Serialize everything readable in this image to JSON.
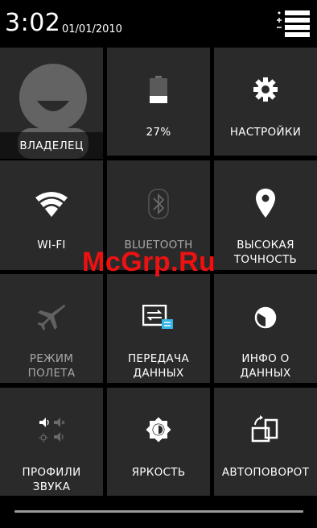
{
  "status_bar": {
    "time": "3:02",
    "date": "01/01/2010",
    "settings_icon": "settings-list-icon"
  },
  "tiles": [
    {
      "label": "ВЛАДЕЛЕЦ",
      "icon": "user-avatar-icon",
      "enabled": true
    },
    {
      "label": "27%",
      "icon": "battery-icon",
      "battery_level": 27,
      "enabled": true
    },
    {
      "label": "НАСТРОЙКИ",
      "icon": "gear-icon",
      "enabled": true
    },
    {
      "label": "WI-FI",
      "icon": "wifi-icon",
      "enabled": true
    },
    {
      "label": "BLUETOOTH",
      "icon": "bluetooth-icon",
      "enabled": false
    },
    {
      "label_line1": "ВЫСОКАЯ",
      "label_line2": "ТОЧНОСТЬ",
      "icon": "location-icon",
      "enabled": true
    },
    {
      "label_line1": "РЕЖИМ",
      "label_line2": "ПОЛЕТА",
      "icon": "airplane-icon",
      "enabled": false
    },
    {
      "label_line1": "ПЕРЕДАЧА",
      "label_line2": "ДАННЫХ",
      "icon": "data-transfer-icon",
      "enabled": true
    },
    {
      "label_line1": "ИНФО О",
      "label_line2": "ДАННЫХ",
      "icon": "data-usage-icon",
      "enabled": true
    },
    {
      "label_line1": "ПРОФИЛИ",
      "label_line2": "ЗВУКА",
      "icon": "sound-profiles-icon",
      "enabled": true
    },
    {
      "label": "ЯРКОСТЬ",
      "icon": "brightness-icon",
      "enabled": true
    },
    {
      "label": "АВТОПОВОРОТ",
      "icon": "auto-rotate-icon",
      "enabled": true
    }
  ],
  "watermark": "McGrp.Ru",
  "colors": {
    "tile_bg": "#2a2a2a",
    "background": "#000000",
    "watermark": "#ee1111",
    "disabled_text": "#a8a8a8"
  }
}
